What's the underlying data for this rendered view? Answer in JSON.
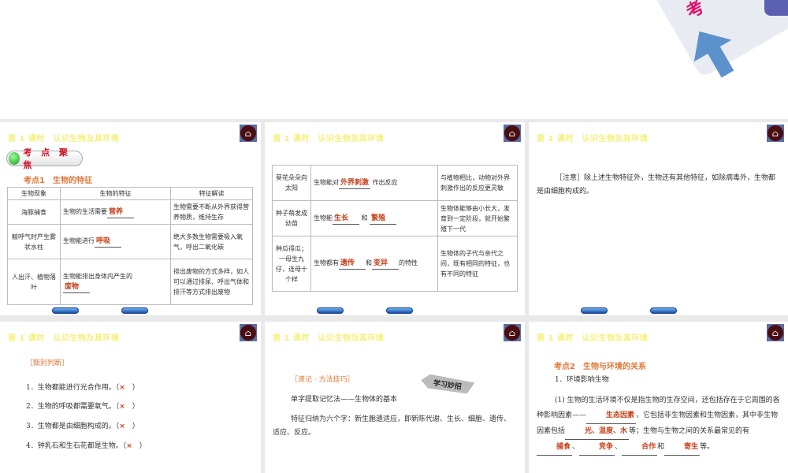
{
  "slide_title": "第 1 课时　认识生物及其环境",
  "slide1": {
    "banner": "考 点 聚 焦",
    "heading": "考点1　生物的特征",
    "headers": [
      "生物现象",
      "生物的特征",
      "特征解读"
    ],
    "rows": [
      {
        "phen": "海豚捕食",
        "pre": "生物的生活需要",
        "ans": "营养",
        "post": "",
        "desc": "生物需要不断从外界获得营养物质，维持生存"
      },
      {
        "phen": "鲸呼气时产生雾状水柱",
        "pre": "生物能进行",
        "ans": "呼吸",
        "post": "",
        "desc": "绝大多数生物需要吸入氧气，呼出二氧化碳"
      },
      {
        "phen": "人出汗、植物落叶",
        "pre": "生物能排出身体内产生的",
        "ans": "废物",
        "post": "",
        "desc": "排出废物的方式多样，如人可以通过排尿、呼出气体和排汗等方式排出废物"
      }
    ]
  },
  "slide2": {
    "rows": [
      {
        "phen": "葵花朵朵向太阳",
        "pre": "生物能对",
        "a1": "外界刺激",
        "mid": "",
        "a2": "",
        "post": "作出反应",
        "desc": "与植物相比，动物对外界刺激作出的反应更灵敏"
      },
      {
        "phen": "种子萌发成幼苗",
        "pre": "生物能",
        "a1": "生长",
        "mid": "和",
        "a2": "繁殖",
        "post": "",
        "desc": "生物体能够由小长大，发育到一定阶段，就开始繁殖下一代"
      },
      {
        "phen": "种瓜得瓜；一母生九仔，连母十个样",
        "pre": "生物都有",
        "a1": "遗传",
        "mid": "和",
        "a2": "变异",
        "post": "的特性",
        "desc": "生物体的子代与亲代之间，既有相同的特征，也有不同的特征"
      }
    ]
  },
  "slide3": {
    "note_label": "［注意］",
    "note": "除上述生物特征外，生物还有其他特征，如除病毒外，生物都是由细胞构成的。"
  },
  "slide4": {
    "heading": "［甄别判断］",
    "mark": "×",
    "items": [
      "1．生物都能进行光合作用。（",
      "2．生物的呼吸都需要氧气。（",
      "3．生物都是由细胞构成的。（",
      "4．钟乳石和生石花都是生物。（"
    ],
    "close": "）"
  },
  "slide5": {
    "heading": "［速记 · 方法技巧］",
    "sign": "学习妙招",
    "line1": "单字提取记忆法——生物体的基本",
    "line2": "特征归纳为六个字：新生胞遗适应，即新陈代谢、生长、细胞、遗传、适应、反应。"
  },
  "slide6": {
    "heading": "考点2　生物与环境的关系",
    "sub": "1．环境影响生物",
    "t1": "(1) 生物的生活环境不仅是指生物的生存空间，还包括存在于它周围的各种影响因素——",
    "a1": "生态因素",
    "t2": "，它包括非生物因素和生物因素，其中非生物因素包括",
    "a2": "光、温度、水",
    "t3": "等；生物与生物之间的关系最常见的有",
    "a3": "捕食",
    "sep": "、",
    "a4": "竞争",
    "a5": "合作",
    "t4": "和",
    "a6": "寄生",
    "t5": "等。"
  }
}
